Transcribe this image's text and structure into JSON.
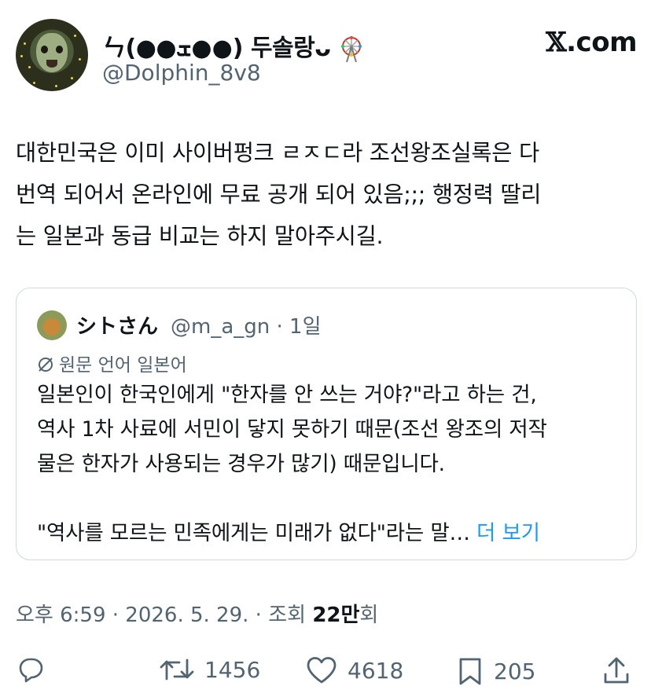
{
  "author": {
    "name_prefix": "ㄣ(●●ܫ●●)",
    "name_korean": "두솔랑",
    "name_suffix": "ᴗ",
    "handle": "@Dolphin_8v8"
  },
  "brand": {
    "x": "𝕏",
    "com": ".com"
  },
  "tweet": {
    "lines": [
      "대한민국은 이미 사이버펑크 ㄹㅈㄷ라 조선왕조실록은 다",
      "번역 되어서 온라인에 무료 공개 되어 있음;;; 행정력 딸리",
      "는 일본과 동급 비교는 하지 말아주시길."
    ]
  },
  "quote": {
    "name": "シトさん",
    "handle_time": "@m_a_gn · 1일",
    "translate_label": "원문 언어 일본어",
    "para1_lines": [
      "일본인이 한국인에게 \"한자를 안 쓰는 거야?\"라고 하는 건,",
      "역사 1차 사료에 서민이 닿지 못하기 때문(조선 왕조의 저작",
      "물은 한자가 사용되는 경우가 많기) 때문입니다."
    ],
    "para2": "\"역사를 모르는 민족에게는 미래가 없다\"라는 말…",
    "more_label": " 더 보기"
  },
  "meta": {
    "time_date": "오후 6:59 · 2026. 5. 29. · 조회 ",
    "views_bold": "22만",
    "views_suffix": "회"
  },
  "actions": {
    "retweets": "1456",
    "likes": "4618",
    "bookmarks": "205"
  },
  "colors": {
    "text": "#0f1419",
    "secondary": "#536471",
    "link": "#1d9bf0",
    "border": "#cfd9de"
  }
}
